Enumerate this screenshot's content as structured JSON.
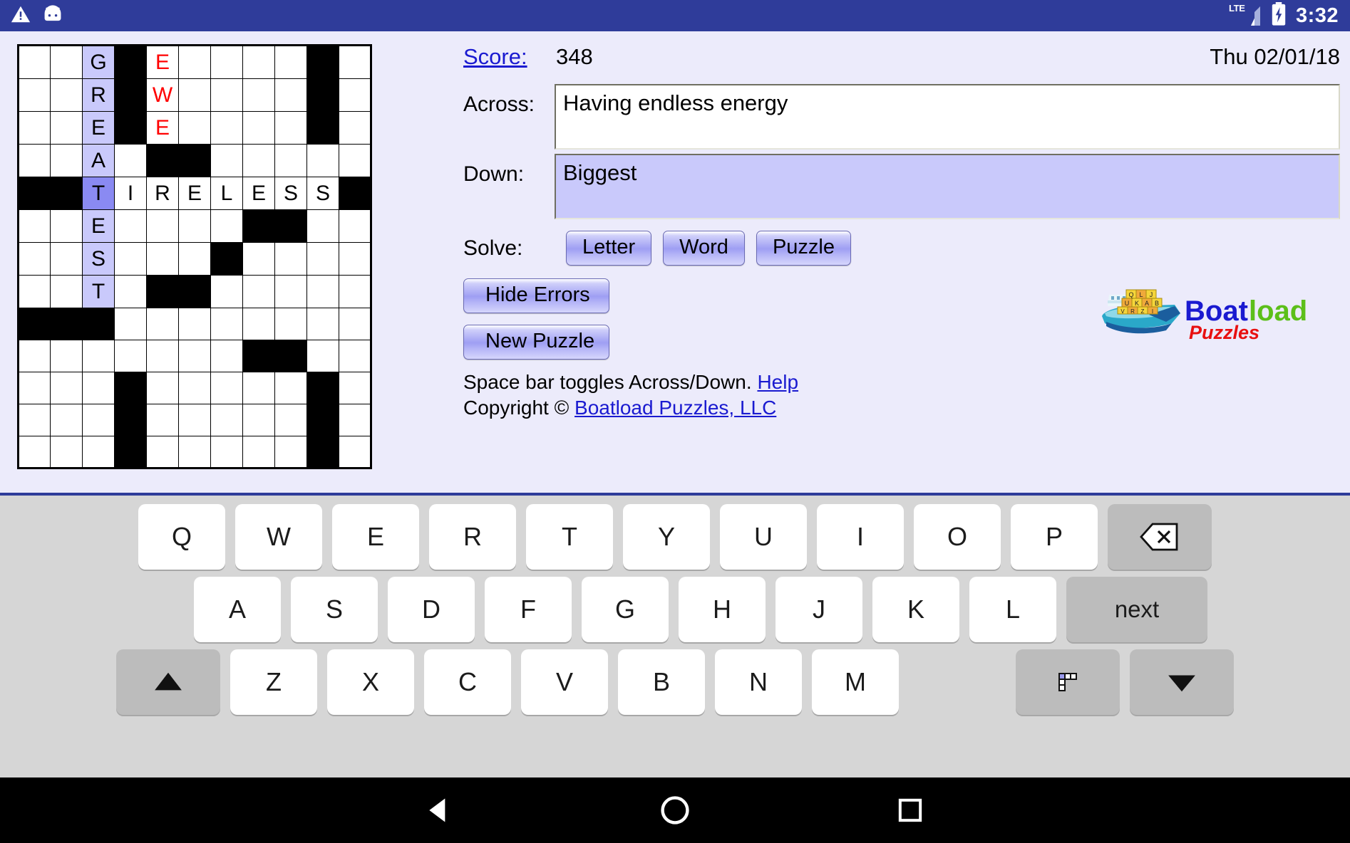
{
  "statusbar": {
    "warning_icon": "warning-triangle-icon",
    "android_icon": "android-head-icon",
    "network_label": "LTE",
    "signal_icon": "signal-bars-icon",
    "battery_icon": "battery-charging-icon",
    "clock": "3:32"
  },
  "panel": {
    "score_label": "Score:",
    "score_value": "348",
    "date": "Thu 02/01/18",
    "across_label": "Across:",
    "across_clue": "Having endless energy",
    "down_label": "Down:",
    "down_clue": "Biggest",
    "solve_label": "Solve:",
    "solve_letter": "Letter",
    "solve_word": "Word",
    "solve_puzzle": "Puzzle",
    "hide_errors": "Hide Errors",
    "new_puzzle": "New Puzzle",
    "hint_text": "Space bar toggles Across/Down.",
    "help_link": "Help",
    "copyright_prefix": "Copyright © ",
    "copyright_link": "Boatload Puzzles, LLC"
  },
  "logo": {
    "word1": "Boat",
    "word2": "load",
    "word3": "Puzzles",
    "color1": "#1a1ad0",
    "color2": "#5cbf1a",
    "color3": "#e81010",
    "block_letters": [
      "Q",
      "L",
      "J",
      "Q",
      "U",
      "L",
      "K",
      "A",
      "B",
      "J",
      "M",
      "V",
      "X",
      "R",
      "G",
      "Z",
      "P",
      "I"
    ]
  },
  "grid": {
    "rows": 13,
    "cols": 11,
    "cells": [
      [
        {
          "t": "",
          "s": "open"
        },
        {
          "t": "",
          "s": "open"
        },
        {
          "t": "G",
          "s": "hl"
        },
        {
          "t": "",
          "s": "block"
        },
        {
          "t": "E",
          "s": "err"
        },
        {
          "t": "",
          "s": "open"
        },
        {
          "t": "",
          "s": "open"
        },
        {
          "t": "",
          "s": "open"
        },
        {
          "t": "",
          "s": "open"
        },
        {
          "t": "",
          "s": "block"
        },
        {
          "t": "",
          "s": "open"
        }
      ],
      [
        {
          "t": "",
          "s": "open"
        },
        {
          "t": "",
          "s": "open"
        },
        {
          "t": "R",
          "s": "hl"
        },
        {
          "t": "",
          "s": "block"
        },
        {
          "t": "W",
          "s": "err"
        },
        {
          "t": "",
          "s": "open"
        },
        {
          "t": "",
          "s": "open"
        },
        {
          "t": "",
          "s": "open"
        },
        {
          "t": "",
          "s": "open"
        },
        {
          "t": "",
          "s": "block"
        },
        {
          "t": "",
          "s": "open"
        }
      ],
      [
        {
          "t": "",
          "s": "open"
        },
        {
          "t": "",
          "s": "open"
        },
        {
          "t": "E",
          "s": "hl"
        },
        {
          "t": "",
          "s": "block"
        },
        {
          "t": "E",
          "s": "err"
        },
        {
          "t": "",
          "s": "open"
        },
        {
          "t": "",
          "s": "open"
        },
        {
          "t": "",
          "s": "open"
        },
        {
          "t": "",
          "s": "open"
        },
        {
          "t": "",
          "s": "block"
        },
        {
          "t": "",
          "s": "open"
        }
      ],
      [
        {
          "t": "",
          "s": "open"
        },
        {
          "t": "",
          "s": "open"
        },
        {
          "t": "A",
          "s": "hl"
        },
        {
          "t": "",
          "s": "open"
        },
        {
          "t": "",
          "s": "block"
        },
        {
          "t": "",
          "s": "block"
        },
        {
          "t": "",
          "s": "open"
        },
        {
          "t": "",
          "s": "open"
        },
        {
          "t": "",
          "s": "open"
        },
        {
          "t": "",
          "s": "open"
        },
        {
          "t": "",
          "s": "open"
        }
      ],
      [
        {
          "t": "",
          "s": "block"
        },
        {
          "t": "",
          "s": "block"
        },
        {
          "t": "T",
          "s": "cur"
        },
        {
          "t": "I",
          "s": "open"
        },
        {
          "t": "R",
          "s": "open"
        },
        {
          "t": "E",
          "s": "open"
        },
        {
          "t": "L",
          "s": "open"
        },
        {
          "t": "E",
          "s": "open"
        },
        {
          "t": "S",
          "s": "open"
        },
        {
          "t": "S",
          "s": "open"
        },
        {
          "t": "",
          "s": "block"
        }
      ],
      [
        {
          "t": "",
          "s": "open"
        },
        {
          "t": "",
          "s": "open"
        },
        {
          "t": "E",
          "s": "hl"
        },
        {
          "t": "",
          "s": "open"
        },
        {
          "t": "",
          "s": "open"
        },
        {
          "t": "",
          "s": "open"
        },
        {
          "t": "",
          "s": "open"
        },
        {
          "t": "",
          "s": "block"
        },
        {
          "t": "",
          "s": "block"
        },
        {
          "t": "",
          "s": "open"
        },
        {
          "t": "",
          "s": "open"
        }
      ],
      [
        {
          "t": "",
          "s": "open"
        },
        {
          "t": "",
          "s": "open"
        },
        {
          "t": "S",
          "s": "hl"
        },
        {
          "t": "",
          "s": "open"
        },
        {
          "t": "",
          "s": "open"
        },
        {
          "t": "",
          "s": "open"
        },
        {
          "t": "",
          "s": "block"
        },
        {
          "t": "",
          "s": "open"
        },
        {
          "t": "",
          "s": "open"
        },
        {
          "t": "",
          "s": "open"
        },
        {
          "t": "",
          "s": "open"
        }
      ],
      [
        {
          "t": "",
          "s": "open"
        },
        {
          "t": "",
          "s": "open"
        },
        {
          "t": "T",
          "s": "hl"
        },
        {
          "t": "",
          "s": "open"
        },
        {
          "t": "",
          "s": "block"
        },
        {
          "t": "",
          "s": "block"
        },
        {
          "t": "",
          "s": "open"
        },
        {
          "t": "",
          "s": "open"
        },
        {
          "t": "",
          "s": "open"
        },
        {
          "t": "",
          "s": "open"
        },
        {
          "t": "",
          "s": "open"
        }
      ],
      [
        {
          "t": "",
          "s": "block"
        },
        {
          "t": "",
          "s": "block"
        },
        {
          "t": "",
          "s": "block"
        },
        {
          "t": "",
          "s": "open"
        },
        {
          "t": "",
          "s": "open"
        },
        {
          "t": "",
          "s": "open"
        },
        {
          "t": "",
          "s": "open"
        },
        {
          "t": "",
          "s": "open"
        },
        {
          "t": "",
          "s": "open"
        },
        {
          "t": "",
          "s": "open"
        },
        {
          "t": "",
          "s": "open"
        }
      ],
      [
        {
          "t": "",
          "s": "open"
        },
        {
          "t": "",
          "s": "open"
        },
        {
          "t": "",
          "s": "open"
        },
        {
          "t": "",
          "s": "open"
        },
        {
          "t": "",
          "s": "open"
        },
        {
          "t": "",
          "s": "open"
        },
        {
          "t": "",
          "s": "open"
        },
        {
          "t": "",
          "s": "block"
        },
        {
          "t": "",
          "s": "block"
        },
        {
          "t": "",
          "s": "open"
        },
        {
          "t": "",
          "s": "open"
        }
      ],
      [
        {
          "t": "",
          "s": "open"
        },
        {
          "t": "",
          "s": "open"
        },
        {
          "t": "",
          "s": "open"
        },
        {
          "t": "",
          "s": "block"
        },
        {
          "t": "",
          "s": "open"
        },
        {
          "t": "",
          "s": "open"
        },
        {
          "t": "",
          "s": "open"
        },
        {
          "t": "",
          "s": "open"
        },
        {
          "t": "",
          "s": "open"
        },
        {
          "t": "",
          "s": "block"
        },
        {
          "t": "",
          "s": "open"
        }
      ],
      [
        {
          "t": "",
          "s": "open"
        },
        {
          "t": "",
          "s": "open"
        },
        {
          "t": "",
          "s": "open"
        },
        {
          "t": "",
          "s": "block"
        },
        {
          "t": "",
          "s": "open"
        },
        {
          "t": "",
          "s": "open"
        },
        {
          "t": "",
          "s": "open"
        },
        {
          "t": "",
          "s": "open"
        },
        {
          "t": "",
          "s": "open"
        },
        {
          "t": "",
          "s": "block"
        },
        {
          "t": "",
          "s": "open"
        }
      ],
      [
        {
          "t": "",
          "s": "open"
        },
        {
          "t": "",
          "s": "open"
        },
        {
          "t": "",
          "s": "open"
        },
        {
          "t": "",
          "s": "block"
        },
        {
          "t": "",
          "s": "open"
        },
        {
          "t": "",
          "s": "open"
        },
        {
          "t": "",
          "s": "open"
        },
        {
          "t": "",
          "s": "open"
        },
        {
          "t": "",
          "s": "open"
        },
        {
          "t": "",
          "s": "block"
        },
        {
          "t": "",
          "s": "open"
        }
      ]
    ]
  },
  "keyboard": {
    "row1": [
      "Q",
      "W",
      "E",
      "R",
      "T",
      "Y",
      "U",
      "I",
      "O",
      "P"
    ],
    "row2": [
      "A",
      "S",
      "D",
      "F",
      "G",
      "H",
      "J",
      "K",
      "L"
    ],
    "row3": [
      "Z",
      "X",
      "C",
      "V",
      "B",
      "N",
      "M"
    ],
    "backspace_icon": "backspace-icon",
    "next_label": "next",
    "shift_icon": "shift-up-arrow-icon",
    "symbols_icon": "keyboard-layout-icon",
    "hide_icon": "down-arrow-icon"
  },
  "navbar": {
    "back_icon": "back-triangle-icon",
    "home_icon": "home-circle-icon",
    "recents_icon": "recents-square-icon"
  }
}
